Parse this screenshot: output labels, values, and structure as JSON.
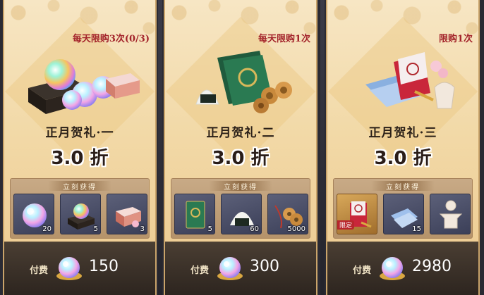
{
  "screen": {
    "reward_section_label": "立刻获得",
    "pay_label": "付费"
  },
  "packs": [
    {
      "limit": "每天限购3次(0/3)",
      "title": "正月贺礼·一",
      "discount": "3.0 折",
      "price": "150",
      "items": [
        {
          "icon": "rainbow-orb-icon",
          "qty": "20",
          "tag": ""
        },
        {
          "icon": "orb-chest-icon",
          "qty": "5",
          "tag": ""
        },
        {
          "icon": "sakura-box-icon",
          "qty": "3",
          "tag": ""
        }
      ]
    },
    {
      "limit": "每天限购1次",
      "title": "正月贺礼·二",
      "discount": "3.0 折",
      "price": "300",
      "items": [
        {
          "icon": "green-card-icon",
          "qty": "5",
          "tag": ""
        },
        {
          "icon": "rice-ball-icon",
          "qty": "60",
          "tag": ""
        },
        {
          "icon": "coin-string-icon",
          "qty": "5000",
          "tag": ""
        }
      ]
    },
    {
      "limit": "限购1次",
      "title": "正月贺礼·三",
      "discount": "3.0 折",
      "price": "2980",
      "items": [
        {
          "icon": "red-envelope-icon",
          "qty": "",
          "tag": "限定"
        },
        {
          "icon": "blue-cloth-icon",
          "qty": "15",
          "tag": ""
        },
        {
          "icon": "paper-doll-icon",
          "qty": "",
          "tag": ""
        }
      ]
    }
  ]
}
